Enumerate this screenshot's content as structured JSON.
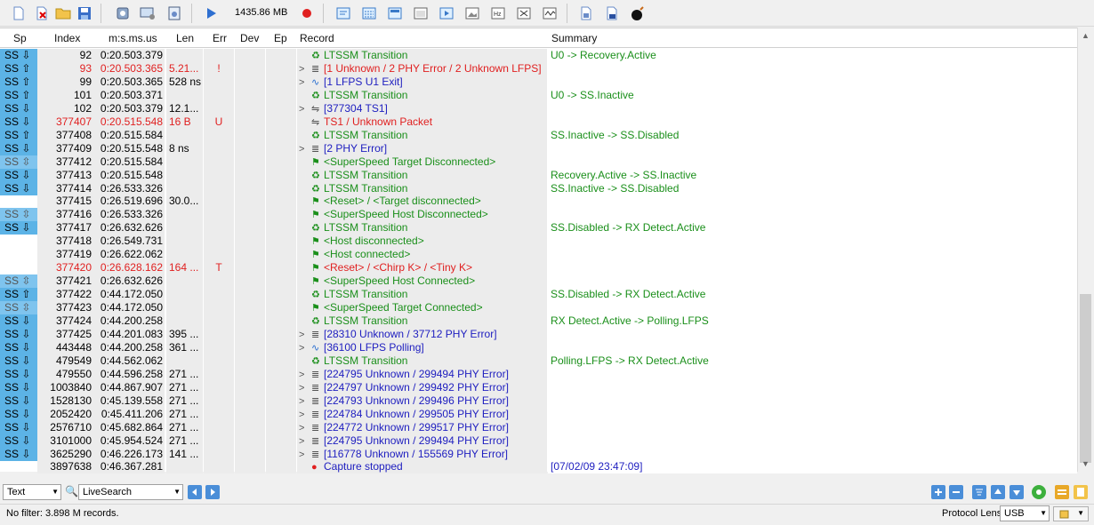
{
  "toolbar": {
    "memory_label": "1435.86 MB"
  },
  "columns": [
    "Sp",
    "Index",
    "m:s.ms.us",
    "Len",
    "Err",
    "Dev",
    "Ep",
    "Record",
    "Summary"
  ],
  "rows": [
    {
      "sp": "SS",
      "dir": "⇩",
      "idx": "92",
      "ts": "0:20.503.379",
      "len": "",
      "err": "",
      "exp": "",
      "ic": "♻",
      "rec": "LTSSM Transition",
      "sum": "U0 -> Recovery.Active",
      "color": "green"
    },
    {
      "sp": "SS",
      "dir": "⇧",
      "idx": "93",
      "ts": "0:20.503.365",
      "len": "5.21...",
      "err": "!",
      "exp": ">",
      "ic": "≣",
      "rec": "[1 Unknown / 2 PHY Error / 2 Unknown LFPS]",
      "sum": "",
      "color": "red"
    },
    {
      "sp": "SS",
      "dir": "⇧",
      "idx": "99",
      "ts": "0:20.503.365",
      "len": "528 ns",
      "err": "",
      "exp": ">",
      "ic": "∿",
      "rec": "[1 LFPS U1 Exit]",
      "sum": "",
      "color": "blue"
    },
    {
      "sp": "SS",
      "dir": "⇧",
      "idx": "101",
      "ts": "0:20.503.371",
      "len": "",
      "err": "",
      "exp": "",
      "ic": "♻",
      "rec": "LTSSM Transition",
      "sum": "U0 -> SS.Inactive",
      "color": "green"
    },
    {
      "sp": "SS",
      "dir": "⇩",
      "idx": "102",
      "ts": "0:20.503.379",
      "len": "12.1...",
      "err": "",
      "exp": ">",
      "ic": "⇋",
      "rec": "[377304 TS1]",
      "sum": "",
      "color": "blue"
    },
    {
      "sp": "SS",
      "dir": "⇩",
      "idx": "377407",
      "ts": "0:20.515.548",
      "len": "16 B",
      "err": "U",
      "exp": "",
      "ic": "⇋",
      "rec": "TS1 / Unknown Packet",
      "sum": "",
      "color": "red"
    },
    {
      "sp": "SS",
      "dir": "⇧",
      "idx": "377408",
      "ts": "0:20.515.584",
      "len": "",
      "err": "",
      "exp": "",
      "ic": "♻",
      "rec": "LTSSM Transition",
      "sum": "SS.Inactive -> SS.Disabled",
      "color": "green"
    },
    {
      "sp": "SS",
      "dir": "⇩",
      "idx": "377409",
      "ts": "0:20.515.548",
      "len": "8 ns",
      "err": "",
      "exp": ">",
      "ic": "≣",
      "rec": "[2 PHY Error]",
      "sum": "",
      "color": "blue"
    },
    {
      "sp": "SS",
      "dir": "⇳",
      "idx": "377412",
      "ts": "0:20.515.584",
      "len": "",
      "err": "",
      "exp": "",
      "ic": "⚑",
      "rec": "<SuperSpeed Target Disconnected>",
      "sum": "",
      "color": "green",
      "lite": true
    },
    {
      "sp": "SS",
      "dir": "⇩",
      "idx": "377413",
      "ts": "0:20.515.548",
      "len": "",
      "err": "",
      "exp": "",
      "ic": "♻",
      "rec": "LTSSM Transition",
      "sum": "Recovery.Active -> SS.Inactive",
      "color": "green"
    },
    {
      "sp": "SS",
      "dir": "⇩",
      "idx": "377414",
      "ts": "0:26.533.326",
      "len": "",
      "err": "",
      "exp": "",
      "ic": "♻",
      "rec": "LTSSM Transition",
      "sum": "SS.Inactive -> SS.Disabled",
      "color": "green"
    },
    {
      "sp": "",
      "dir": "",
      "idx": "377415",
      "ts": "0:26.519.696",
      "len": "30.0...",
      "err": "",
      "exp": "",
      "ic": "⚑",
      "rec": "<Reset> / <Target disconnected>",
      "sum": "",
      "color": "green"
    },
    {
      "sp": "SS",
      "dir": "⇳",
      "idx": "377416",
      "ts": "0:26.533.326",
      "len": "",
      "err": "",
      "exp": "",
      "ic": "⚑",
      "rec": "<SuperSpeed Host Disconnected>",
      "sum": "",
      "color": "green",
      "lite": true
    },
    {
      "sp": "SS",
      "dir": "⇩",
      "idx": "377417",
      "ts": "0:26.632.626",
      "len": "",
      "err": "",
      "exp": "",
      "ic": "♻",
      "rec": "LTSSM Transition",
      "sum": "SS.Disabled -> RX Detect.Active",
      "color": "green"
    },
    {
      "sp": "",
      "dir": "",
      "idx": "377418",
      "ts": "0:26.549.731",
      "len": "",
      "err": "",
      "exp": "",
      "ic": "⚑",
      "rec": "<Host disconnected>",
      "sum": "",
      "color": "green"
    },
    {
      "sp": "",
      "dir": "",
      "idx": "377419",
      "ts": "0:26.622.062",
      "len": "",
      "err": "",
      "exp": "",
      "ic": "⚑",
      "rec": "<Host connected>",
      "sum": "",
      "color": "green"
    },
    {
      "sp": "",
      "dir": "",
      "idx": "377420",
      "ts": "0:26.628.162",
      "len": "164 ...",
      "err": "T",
      "exp": "",
      "ic": "⚑",
      "rec": "<Reset> / <Chirp K> / <Tiny K>",
      "sum": "",
      "color": "red"
    },
    {
      "sp": "SS",
      "dir": "⇳",
      "idx": "377421",
      "ts": "0:26.632.626",
      "len": "",
      "err": "",
      "exp": "",
      "ic": "⚑",
      "rec": "<SuperSpeed Host Connected>",
      "sum": "",
      "color": "green",
      "lite": true
    },
    {
      "sp": "SS",
      "dir": "⇧",
      "idx": "377422",
      "ts": "0:44.172.050",
      "len": "",
      "err": "",
      "exp": "",
      "ic": "♻",
      "rec": "LTSSM Transition",
      "sum": "SS.Disabled -> RX Detect.Active",
      "color": "green"
    },
    {
      "sp": "SS",
      "dir": "⇳",
      "idx": "377423",
      "ts": "0:44.172.050",
      "len": "",
      "err": "",
      "exp": "",
      "ic": "⚑",
      "rec": "<SuperSpeed Target Connected>",
      "sum": "",
      "color": "green",
      "lite": true
    },
    {
      "sp": "SS",
      "dir": "⇩",
      "idx": "377424",
      "ts": "0:44.200.258",
      "len": "",
      "err": "",
      "exp": "",
      "ic": "♻",
      "rec": "LTSSM Transition",
      "sum": "RX Detect.Active -> Polling.LFPS",
      "color": "green"
    },
    {
      "sp": "SS",
      "dir": "⇩",
      "idx": "377425",
      "ts": "0:44.201.083",
      "len": "395 ...",
      "err": "",
      "exp": ">",
      "ic": "≣",
      "rec": "[28310 Unknown / 37712 PHY Error]",
      "sum": "",
      "color": "blue"
    },
    {
      "sp": "SS",
      "dir": "⇩",
      "idx": "443448",
      "ts": "0:44.200.258",
      "len": "361 ...",
      "err": "",
      "exp": ">",
      "ic": "∿",
      "rec": "[36100 LFPS Polling]",
      "sum": "",
      "color": "blue"
    },
    {
      "sp": "SS",
      "dir": "⇩",
      "idx": "479549",
      "ts": "0:44.562.062",
      "len": "",
      "err": "",
      "exp": "",
      "ic": "♻",
      "rec": "LTSSM Transition",
      "sum": "Polling.LFPS -> RX Detect.Active",
      "color": "green"
    },
    {
      "sp": "SS",
      "dir": "⇩",
      "idx": "479550",
      "ts": "0:44.596.258",
      "len": "271 ...",
      "err": "",
      "exp": ">",
      "ic": "≣",
      "rec": "[224795 Unknown / 299494 PHY Error]",
      "sum": "",
      "color": "blue"
    },
    {
      "sp": "SS",
      "dir": "⇩",
      "idx": "1003840",
      "ts": "0:44.867.907",
      "len": "271 ...",
      "err": "",
      "exp": ">",
      "ic": "≣",
      "rec": "[224797 Unknown / 299492 PHY Error]",
      "sum": "",
      "color": "blue"
    },
    {
      "sp": "SS",
      "dir": "⇩",
      "idx": "1528130",
      "ts": "0:45.139.558",
      "len": "271 ...",
      "err": "",
      "exp": ">",
      "ic": "≣",
      "rec": "[224793 Unknown / 299496 PHY Error]",
      "sum": "",
      "color": "blue"
    },
    {
      "sp": "SS",
      "dir": "⇩",
      "idx": "2052420",
      "ts": "0:45.411.206",
      "len": "271 ...",
      "err": "",
      "exp": ">",
      "ic": "≣",
      "rec": "[224784 Unknown / 299505 PHY Error]",
      "sum": "",
      "color": "blue"
    },
    {
      "sp": "SS",
      "dir": "⇩",
      "idx": "2576710",
      "ts": "0:45.682.864",
      "len": "271 ...",
      "err": "",
      "exp": ">",
      "ic": "≣",
      "rec": "[224772 Unknown / 299517 PHY Error]",
      "sum": "",
      "color": "blue"
    },
    {
      "sp": "SS",
      "dir": "⇩",
      "idx": "3101000",
      "ts": "0:45.954.524",
      "len": "271 ...",
      "err": "",
      "exp": ">",
      "ic": "≣",
      "rec": "[224795 Unknown / 299494 PHY Error]",
      "sum": "",
      "color": "blue"
    },
    {
      "sp": "SS",
      "dir": "⇩",
      "idx": "3625290",
      "ts": "0:46.226.173",
      "len": "141 ...",
      "err": "",
      "exp": ">",
      "ic": "≣",
      "rec": "[116778 Unknown / 155569 PHY Error]",
      "sum": "",
      "color": "blue"
    },
    {
      "sp": "",
      "dir": "",
      "idx": "3897638",
      "ts": "0:46.367.281",
      "len": "",
      "err": "",
      "exp": "",
      "ic": "●",
      "rec": "Capture stopped",
      "sum": "[07/02/09 23:47:09]",
      "color": "blue",
      "stop": true
    }
  ],
  "bottom": {
    "view_mode": "Text",
    "search_mode": "LiveSearch"
  },
  "status": {
    "filter_text": "No filter: 3.898 M records.",
    "lens_label": "Protocol Lens:",
    "lens_value": "USB"
  },
  "colors": {
    "accent": "#5cb3e6",
    "green": "#1a8f1a",
    "red": "#e02020",
    "blue": "#2020c0"
  }
}
